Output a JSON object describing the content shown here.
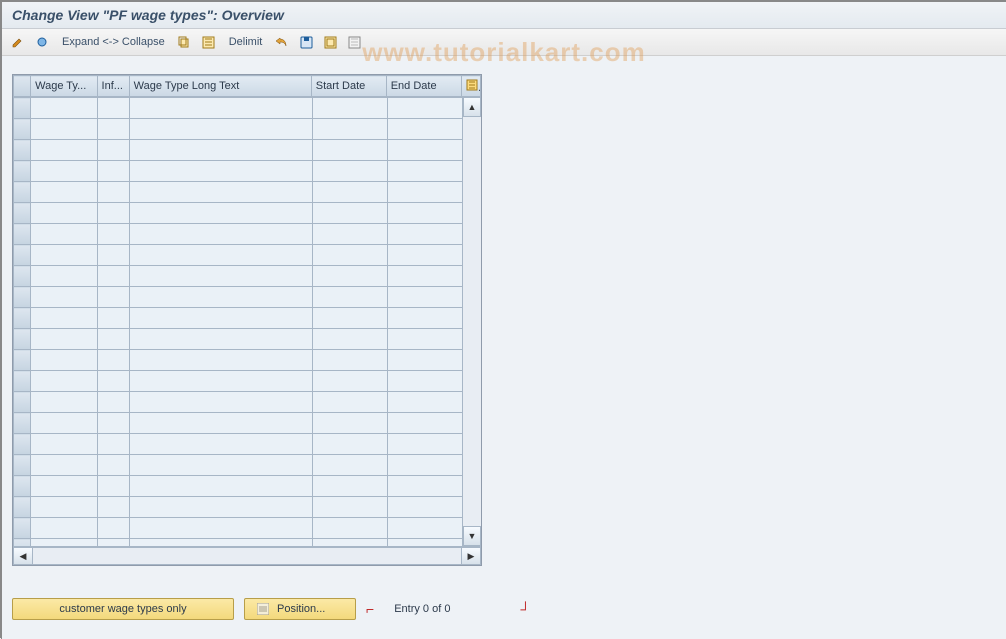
{
  "title": "Change View \"PF wage types\": Overview",
  "toolbar": {
    "expand_collapse": "Expand <-> Collapse",
    "delimit": "Delimit"
  },
  "table": {
    "columns": {
      "wage_type": "Wage Ty...",
      "inf": "Inf...",
      "long_text": "Wage Type Long Text",
      "start_date": "Start Date",
      "end_date": "End Date"
    },
    "row_count": 23
  },
  "footer": {
    "customer_btn": "customer wage types only",
    "position_btn": "Position...",
    "entry_status": "Entry 0 of 0"
  },
  "watermark": "www.tutorialkart.com"
}
